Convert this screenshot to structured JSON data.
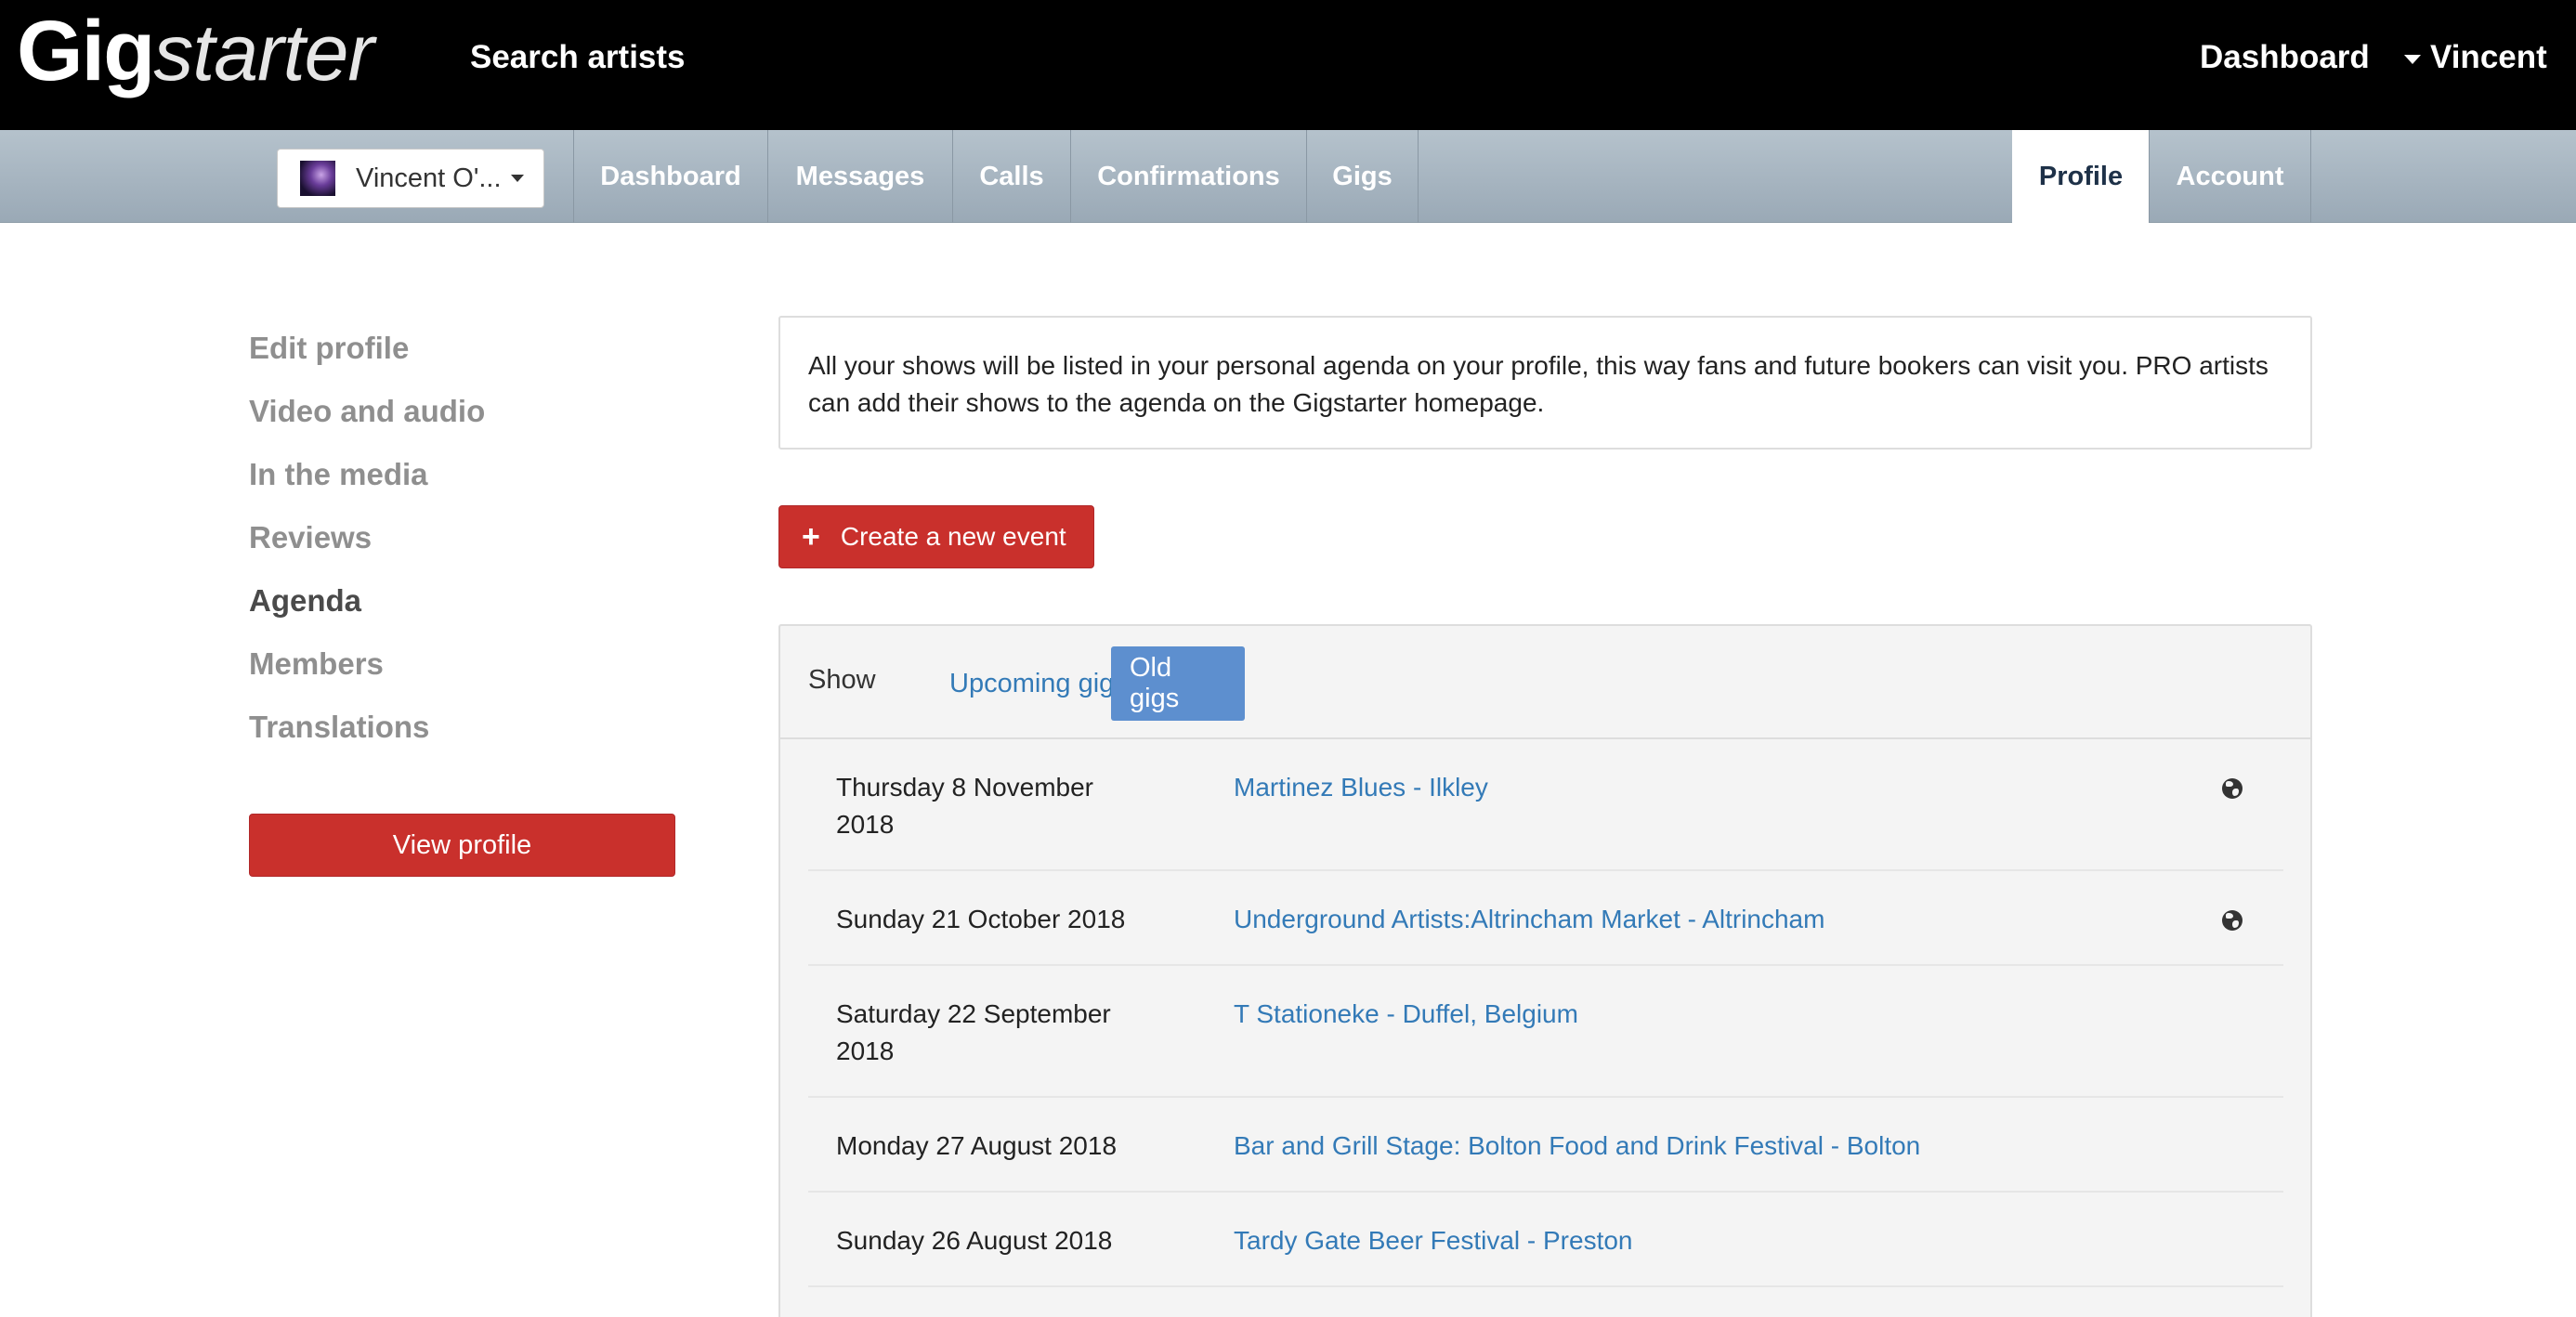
{
  "header": {
    "logo_bold": "Gig",
    "logo_italic": "starter",
    "search_link": "Search artists",
    "dashboard_link": "Dashboard",
    "user_name": "Vincent"
  },
  "subnav": {
    "artist_select": "Vincent O'...",
    "tabs": [
      "Dashboard",
      "Messages",
      "Calls",
      "Confirmations",
      "Gigs"
    ],
    "right_tabs": [
      "Profile",
      "Account"
    ],
    "active_tab": "Profile"
  },
  "sidebar": {
    "items": [
      "Edit profile",
      "Video and audio",
      "In the media",
      "Reviews",
      "Agenda",
      "Members",
      "Translations"
    ],
    "active_item": "Agenda",
    "view_profile_button": "View profile"
  },
  "main": {
    "info_text": "All your shows will be listed in your personal agenda on your profile, this way fans and future bookers can visit you. PRO artists can add their shows to the agenda on the Gigstarter homepage.",
    "create_button": "Create a new event",
    "filter": {
      "label": "Show",
      "upcoming": "Upcoming gigs",
      "old": "Old gigs",
      "selected": "Old gigs"
    },
    "gigs": [
      {
        "date": "Thursday 8 November 2018",
        "title": "Martinez Blues - Ilkley",
        "public_icon": "globe-icon"
      },
      {
        "date": "Sunday 21 October 2018",
        "title": "Underground Artists:Altrincham Market - Altrincham",
        "public_icon": "globe-icon"
      },
      {
        "date": "Saturday 22 September 2018",
        "title": "T Stationeke - Duffel, Belgium",
        "public_icon": ""
      },
      {
        "date": "Monday 27 August 2018",
        "title": "Bar and Grill Stage: Bolton Food and Drink Festival - Bolton",
        "public_icon": ""
      },
      {
        "date": "Sunday 26 August 2018",
        "title": "Tardy Gate Beer Festival - Preston",
        "public_icon": ""
      }
    ]
  },
  "colors": {
    "top_bar": "#000000",
    "subnav": "#a9b7c2",
    "accent_red": "#c9302c",
    "link_blue": "#337ab7",
    "active_filter": "#5d8fcf"
  }
}
